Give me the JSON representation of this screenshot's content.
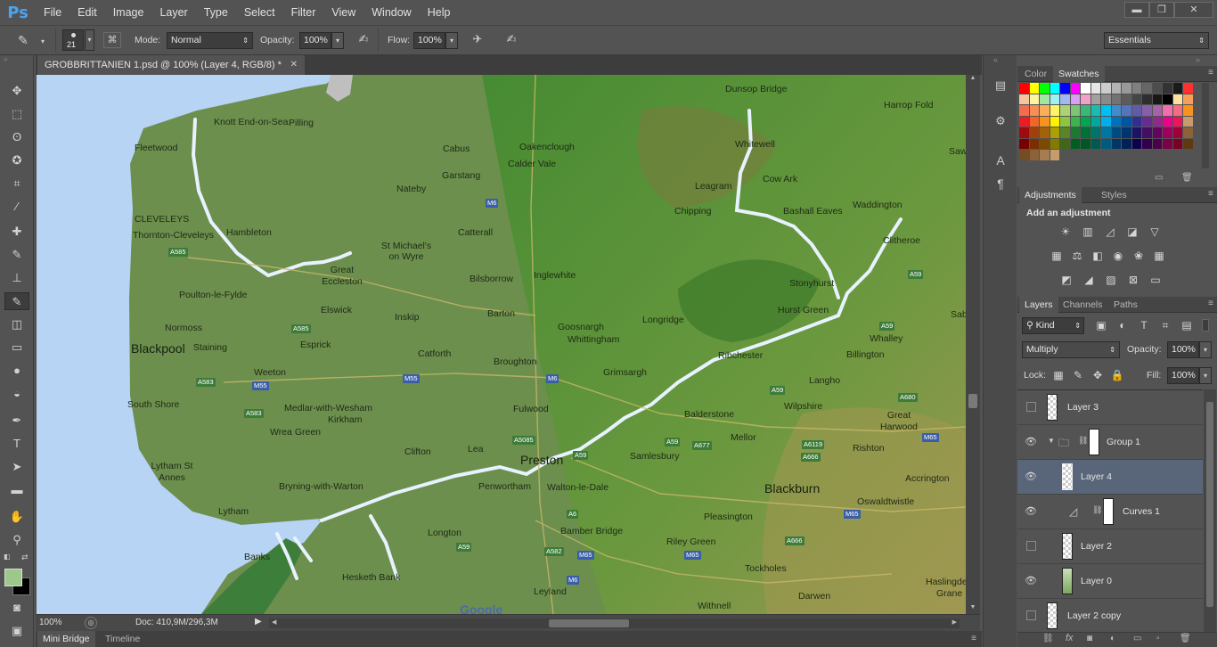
{
  "app": {
    "logo": "Ps"
  },
  "menu": [
    "File",
    "Edit",
    "Image",
    "Layer",
    "Type",
    "Select",
    "Filter",
    "View",
    "Window",
    "Help"
  ],
  "window_controls": {
    "minimize": "▬",
    "restore": "❐",
    "close": "✕"
  },
  "options": {
    "brush_size": "21",
    "mode_label": "Mode:",
    "mode_value": "Normal",
    "opacity_label": "Opacity:",
    "opacity_value": "100%",
    "flow_label": "Flow:",
    "flow_value": "100%",
    "workspace": "Essentials"
  },
  "document": {
    "tab_title": "GROBBRITTANIEN 1.psd @ 100% (Layer 4, RGB/8) *",
    "zoom": "100%",
    "doc_info": "Doc: 410,9M/296,3M"
  },
  "bottom_tabs": [
    "Mini Bridge",
    "Timeline"
  ],
  "map": {
    "places": [
      {
        "name": "Dunsop Bridge"
      },
      {
        "name": "Harrop Fold"
      },
      {
        "name": "Knott End-on-Sea"
      },
      {
        "name": "Pilling"
      },
      {
        "name": "Cabus"
      },
      {
        "name": "Oakenclough"
      },
      {
        "name": "Calder Vale"
      },
      {
        "name": "Whitewell"
      },
      {
        "name": "Garstang"
      },
      {
        "name": "Leagram"
      },
      {
        "name": "Cow Ark"
      },
      {
        "name": "Nateby"
      },
      {
        "name": "Chipping"
      },
      {
        "name": "Bashall Eaves"
      },
      {
        "name": "Waddington"
      },
      {
        "name": "Fleetwood"
      },
      {
        "name": "CLEVELEYS"
      },
      {
        "name": "Thornton-Cleveleys"
      },
      {
        "name": "Hambleton"
      },
      {
        "name": "Catterall"
      },
      {
        "name": "Clitheroe"
      },
      {
        "name": "St Michael's on Wyre"
      },
      {
        "name": "Great Eccleston"
      },
      {
        "name": "Inglewhite"
      },
      {
        "name": "Poulton-le-Fylde"
      },
      {
        "name": "Bilsborrow"
      },
      {
        "name": "Stonyhurst"
      },
      {
        "name": "Elswick"
      },
      {
        "name": "Inskip"
      },
      {
        "name": "Barton"
      },
      {
        "name": "Hurst Green"
      },
      {
        "name": "Longridge"
      },
      {
        "name": "Normoss"
      },
      {
        "name": "Goosnargh"
      },
      {
        "name": "Whittingham"
      },
      {
        "name": "Whalley"
      },
      {
        "name": "Blackpool"
      },
      {
        "name": "Staining"
      },
      {
        "name": "Esprick"
      },
      {
        "name": "Billington"
      },
      {
        "name": "Catforth"
      },
      {
        "name": "Ribchester"
      },
      {
        "name": "Broughton"
      },
      {
        "name": "Weeton"
      },
      {
        "name": "Grimsargh"
      },
      {
        "name": "Langho"
      },
      {
        "name": "South Shore"
      },
      {
        "name": "Medlar-with-Wesham"
      },
      {
        "name": "Kirkham"
      },
      {
        "name": "Wilpshire"
      },
      {
        "name": "Fulwood"
      },
      {
        "name": "Balderstone"
      },
      {
        "name": "Great Harwood"
      },
      {
        "name": "Wrea Green"
      },
      {
        "name": "Mellor"
      },
      {
        "name": "Clifton"
      },
      {
        "name": "Lea"
      },
      {
        "name": "Rishton"
      },
      {
        "name": "Preston"
      },
      {
        "name": "Samlesbury"
      },
      {
        "name": "Lytham St Annes"
      },
      {
        "name": "Accrington"
      },
      {
        "name": "Bryning-with-Warton"
      },
      {
        "name": "Penwortham"
      },
      {
        "name": "Walton-le-Dale"
      },
      {
        "name": "Blackburn"
      },
      {
        "name": "Oswaldtwistle"
      },
      {
        "name": "Lytham"
      },
      {
        "name": "Pleasington"
      },
      {
        "name": "Bamber Bridge"
      },
      {
        "name": "Longton"
      },
      {
        "name": "Riley Green"
      },
      {
        "name": "Tockholes"
      },
      {
        "name": "Hesketh Bank"
      },
      {
        "name": "Leyland"
      },
      {
        "name": "Darwen"
      },
      {
        "name": "Withnell"
      },
      {
        "name": "Haslingden"
      },
      {
        "name": "Grane"
      },
      {
        "name": "Sabden"
      },
      {
        "name": "Sawley"
      },
      {
        "name": "Banks"
      }
    ],
    "roads": [
      "M6",
      "A585",
      "A585",
      "A583",
      "M55",
      "M55",
      "A583",
      "M6",
      "A5085",
      "A59",
      "A6",
      "A582",
      "M65",
      "M6",
      "M65",
      "A677",
      "A59",
      "A59",
      "A59",
      "A666",
      "A6119",
      "A680",
      "M65",
      "M65",
      "A666",
      "A59",
      "A59"
    ],
    "attribution": "Google"
  },
  "panels": {
    "color_tabs": [
      "Color",
      "Swatches"
    ],
    "adjust_tabs": [
      "Adjustments",
      "Styles"
    ],
    "adjust_heading": "Add an adjustment",
    "layer_tabs": [
      "Layers",
      "Channels",
      "Paths"
    ],
    "kind_filter": "Kind",
    "blend_mode": "Multiply",
    "opacity_label": "Opacity:",
    "opacity_value": "100%",
    "lock_label": "Lock:",
    "fill_label": "Fill:",
    "fill_value": "100%",
    "layers": [
      {
        "name": "Layer 3",
        "visible": false,
        "indent": 0,
        "selected": false
      },
      {
        "name": "Group 1",
        "visible": true,
        "indent": 0,
        "selected": false
      },
      {
        "name": "Layer 4",
        "visible": true,
        "indent": 1,
        "selected": true
      },
      {
        "name": "Curves 1",
        "visible": true,
        "indent": 1,
        "selected": false
      },
      {
        "name": "Layer 2",
        "visible": false,
        "indent": 1,
        "selected": false
      },
      {
        "name": "Layer 0",
        "visible": true,
        "indent": 1,
        "selected": false
      },
      {
        "name": "Layer 2 copy",
        "visible": false,
        "indent": 0,
        "selected": false
      }
    ]
  },
  "colors": {
    "foreground": "#9cc98a",
    "background": "#000000",
    "selected_layer": "#596579",
    "accent": "#4aa4f0"
  }
}
